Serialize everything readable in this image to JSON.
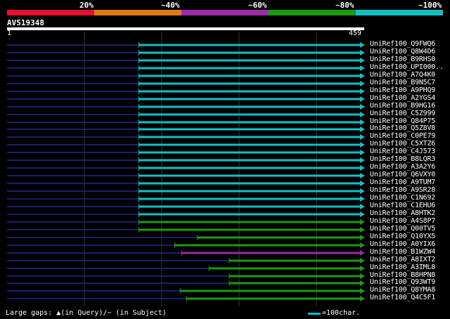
{
  "scale": {
    "labels": [
      "20%",
      "~40%",
      "~60%",
      "~80%",
      "~100%"
    ],
    "colors": [
      "#e8102e",
      "#e07818",
      "#9a2aa8",
      "#1a9c10",
      "#10c0c8"
    ]
  },
  "query": {
    "name": "AV519348",
    "start": "1",
    "end": "459",
    "length": 459
  },
  "hits": [
    {
      "label": "UniRef100_Q9FWQ6",
      "start": 1,
      "hit_start": 170,
      "end": 459,
      "color": "#10c0c8"
    },
    {
      "label": "UniRef100_Q8W4D6",
      "start": 1,
      "hit_start": 170,
      "end": 459,
      "color": "#10c0c8"
    },
    {
      "label": "UniRef100_B9RHS0",
      "start": 1,
      "hit_start": 170,
      "end": 459,
      "color": "#10c0c8"
    },
    {
      "label": "UniRef100_UPI000..",
      "start": 1,
      "hit_start": 170,
      "end": 459,
      "color": "#10c0c8"
    },
    {
      "label": "UniRef100_A7Q4K0",
      "start": 1,
      "hit_start": 170,
      "end": 459,
      "color": "#10c0c8"
    },
    {
      "label": "UniRef100_B9N5C7",
      "start": 1,
      "hit_start": 170,
      "end": 459,
      "color": "#10c0c8"
    },
    {
      "label": "UniRef100_A9PHQ9",
      "start": 1,
      "hit_start": 170,
      "end": 459,
      "color": "#10c0c8"
    },
    {
      "label": "UniRef100_A2YGS4",
      "start": 1,
      "hit_start": 170,
      "end": 459,
      "color": "#10c0c8"
    },
    {
      "label": "UniRef100_B9HG16",
      "start": 1,
      "hit_start": 170,
      "end": 459,
      "color": "#10c0c8"
    },
    {
      "label": "UniRef100_C5Z999",
      "start": 1,
      "hit_start": 170,
      "end": 459,
      "color": "#10c0c8"
    },
    {
      "label": "UniRef100_Q84P75",
      "start": 1,
      "hit_start": 170,
      "end": 459,
      "color": "#10c0c8"
    },
    {
      "label": "UniRef100_Q5Z8V8",
      "start": 1,
      "hit_start": 170,
      "end": 459,
      "color": "#10c0c8"
    },
    {
      "label": "UniRef100_C0PE79",
      "start": 1,
      "hit_start": 170,
      "end": 459,
      "color": "#10c0c8"
    },
    {
      "label": "UniRef100_C5XTZ6",
      "start": 1,
      "hit_start": 170,
      "end": 459,
      "color": "#10c0c8"
    },
    {
      "label": "UniRef100_C4J573",
      "start": 1,
      "hit_start": 170,
      "end": 459,
      "color": "#10c0c8"
    },
    {
      "label": "UniRef100_B8LQR3",
      "start": 1,
      "hit_start": 170,
      "end": 459,
      "color": "#10c0c8"
    },
    {
      "label": "UniRef100_A3A2Y6",
      "start": 1,
      "hit_start": 170,
      "end": 459,
      "color": "#10c0c8"
    },
    {
      "label": "UniRef100_Q6VXY0",
      "start": 1,
      "hit_start": 170,
      "end": 459,
      "color": "#10c0c8"
    },
    {
      "label": "UniRef100_A9TUM7",
      "start": 1,
      "hit_start": 170,
      "end": 459,
      "color": "#10c0c8"
    },
    {
      "label": "UniRef100_A9SR28",
      "start": 1,
      "hit_start": 170,
      "end": 459,
      "color": "#10c0c8"
    },
    {
      "label": "UniRef100_C1N692",
      "start": 1,
      "hit_start": 170,
      "end": 459,
      "color": "#10c0c8"
    },
    {
      "label": "UniRef100_C1EHU6",
      "start": 1,
      "hit_start": 170,
      "end": 459,
      "color": "#10c0c8"
    },
    {
      "label": "UniRef100_A8HTK2",
      "start": 1,
      "hit_start": 170,
      "end": 459,
      "color": "#10c0c8"
    },
    {
      "label": "UniRef100_A4S8P7",
      "start": 1,
      "hit_start": 170,
      "end": 459,
      "color": "#1a9c10"
    },
    {
      "label": "UniRef100_Q00TV5",
      "start": 1,
      "hit_start": 170,
      "end": 459,
      "color": "#1a9c10"
    },
    {
      "label": "UniRef100_Q10YX5",
      "start": 1,
      "hit_start": 245,
      "end": 459,
      "color": "#1a9c10"
    },
    {
      "label": "UniRef100_A0YIX6",
      "start": 1,
      "hit_start": 216,
      "end": 459,
      "color": "#1a9c10"
    },
    {
      "label": "UniRef100_B1WZW4",
      "start": 1,
      "hit_start": 225,
      "end": 459,
      "color": "#9a2aa8"
    },
    {
      "label": "UniRef100_A8IXT2",
      "start": 1,
      "hit_start": 286,
      "end": 459,
      "color": "#1a9c10"
    },
    {
      "label": "UniRef100_A3IML8",
      "start": 1,
      "hit_start": 260,
      "end": 459,
      "color": "#1a9c10"
    },
    {
      "label": "UniRef100_B8HPN8",
      "start": 1,
      "hit_start": 286,
      "end": 459,
      "color": "#1a9c10"
    },
    {
      "label": "UniRef100_Q93WT9",
      "start": 1,
      "hit_start": 286,
      "end": 459,
      "color": "#1a9c10"
    },
    {
      "label": "UniRef100_Q8YMA8",
      "start": 1,
      "hit_start": 223,
      "end": 459,
      "color": "#1a9c10"
    },
    {
      "label": "UniRef100_Q4C5F1",
      "start": 1,
      "hit_start": 231,
      "end": 459,
      "color": "#1a9c10"
    }
  ],
  "footer": {
    "gaps_text": "Large gaps: ▲(in Query)/~ (in Subject)",
    "legend_text": "=100char."
  }
}
